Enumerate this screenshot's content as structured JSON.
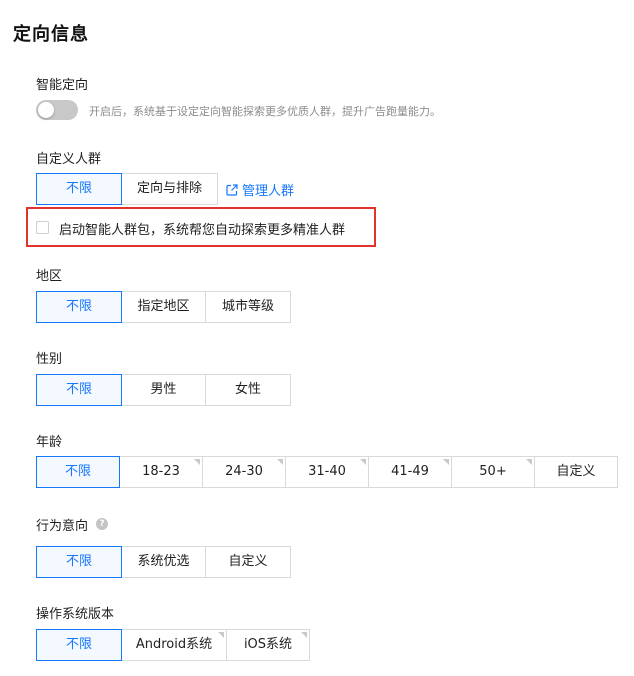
{
  "title": "定向信息",
  "smart_targeting": {
    "label": "智能定向",
    "hint": "开启后，系统基于设定定向智能探索更多优质人群，提升广告跑量能力。"
  },
  "custom_audience": {
    "label": "自定义人群",
    "options": [
      "不限",
      "定向与排除"
    ],
    "manage_link": "管理人群",
    "checkbox_label": "启动智能人群包，系统帮您自动探索更多精准人群"
  },
  "region": {
    "label": "地区",
    "options": [
      "不限",
      "指定地区",
      "城市等级"
    ]
  },
  "gender": {
    "label": "性别",
    "options": [
      "不限",
      "男性",
      "女性"
    ]
  },
  "age": {
    "label": "年龄",
    "options": [
      "不限",
      "18-23",
      "24-30",
      "31-40",
      "41-49",
      "50+",
      "自定义"
    ]
  },
  "behavior": {
    "label": "行为意向",
    "help_icon": "?",
    "options": [
      "不限",
      "系统优选",
      "自定义"
    ]
  },
  "os": {
    "label": "操作系统版本",
    "options": [
      "不限",
      "Android系统",
      "iOS系统"
    ]
  },
  "colors": {
    "accent": "#1677ff",
    "highlight": "#e3312b"
  }
}
